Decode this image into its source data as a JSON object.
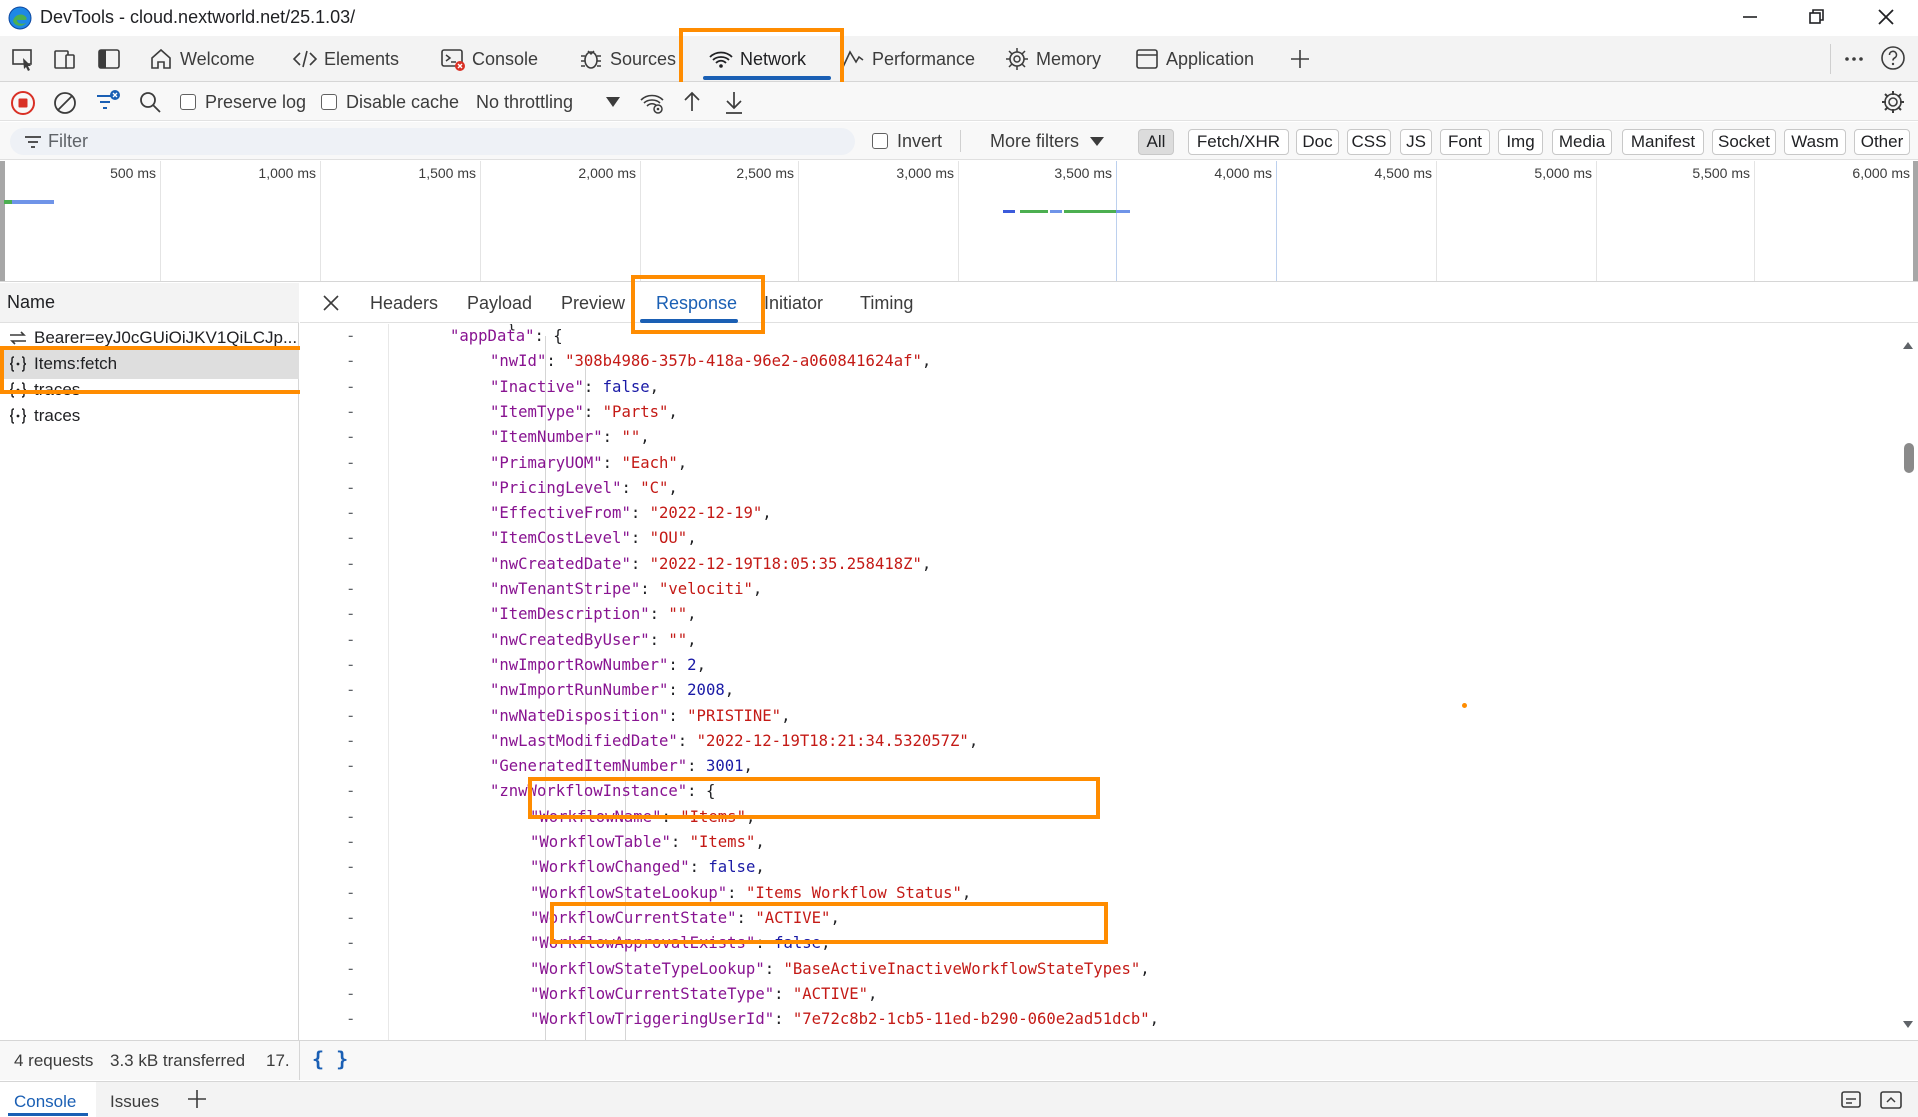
{
  "window": {
    "title": "DevTools - cloud.nextworld.net/25.1.03/"
  },
  "main_tabs": {
    "welcome": "Welcome",
    "elements": "Elements",
    "console": "Console",
    "sources": "Sources",
    "network": "Network",
    "performance": "Performance",
    "memory": "Memory",
    "application": "Application"
  },
  "toolbar": {
    "preserve_log": "Preserve log",
    "disable_cache": "Disable cache",
    "throttling": "No throttling"
  },
  "filterbar": {
    "filter_placeholder": "Filter",
    "invert": "Invert",
    "more_filters": "More filters",
    "chips": [
      "All",
      "Fetch/XHR",
      "Doc",
      "CSS",
      "JS",
      "Font",
      "Img",
      "Media",
      "Manifest",
      "Socket",
      "Wasm",
      "Other"
    ]
  },
  "timeline": {
    "ticks": [
      "500 ms",
      "1,000 ms",
      "1,500 ms",
      "2,000 ms",
      "2,500 ms",
      "3,000 ms",
      "3,500 ms",
      "4,000 ms",
      "4,500 ms",
      "5,000 ms",
      "5,500 ms",
      "6,000 ms"
    ]
  },
  "request_list": {
    "header": "Name",
    "items": [
      "Bearer=eyJ0cGUiOiJKV1QiLCJp...",
      "Items:fetch",
      "traces",
      "traces"
    ]
  },
  "details": {
    "tabs": {
      "headers": "Headers",
      "payload": "Payload",
      "preview": "Preview",
      "response": "Response",
      "initiator": "Initiator",
      "timing": "Timing"
    },
    "response_lines": [
      {
        "indent": 0,
        "key": "appData",
        "value": "{",
        "vtype": "open"
      },
      {
        "indent": 1,
        "key": "nwId",
        "value": "\"308b4986-357b-418a-96e2-a060841624af\"",
        "vtype": "string"
      },
      {
        "indent": 1,
        "key": "Inactive",
        "value": "false",
        "vtype": "keyword"
      },
      {
        "indent": 1,
        "key": "ItemType",
        "value": "\"Parts\"",
        "vtype": "string"
      },
      {
        "indent": 1,
        "key": "ItemNumber",
        "value": "\"\"",
        "vtype": "string"
      },
      {
        "indent": 1,
        "key": "PrimaryUOM",
        "value": "\"Each\"",
        "vtype": "string"
      },
      {
        "indent": 1,
        "key": "PricingLevel",
        "value": "\"C\"",
        "vtype": "string"
      },
      {
        "indent": 1,
        "key": "EffectiveFrom",
        "value": "\"2022-12-19\"",
        "vtype": "string"
      },
      {
        "indent": 1,
        "key": "ItemCostLevel",
        "value": "\"OU\"",
        "vtype": "string"
      },
      {
        "indent": 1,
        "key": "nwCreatedDate",
        "value": "\"2022-12-19T18:05:35.258418Z\"",
        "vtype": "string"
      },
      {
        "indent": 1,
        "key": "nwTenantStripe",
        "value": "\"velociti\"",
        "vtype": "string"
      },
      {
        "indent": 1,
        "key": "ItemDescription",
        "value": "\"\"",
        "vtype": "string"
      },
      {
        "indent": 1,
        "key": "nwCreatedByUser",
        "value": "\"\"",
        "vtype": "string"
      },
      {
        "indent": 1,
        "key": "nwImportRowNumber",
        "value": "2",
        "vtype": "number"
      },
      {
        "indent": 1,
        "key": "nwImportRunNumber",
        "value": "2008",
        "vtype": "number"
      },
      {
        "indent": 1,
        "key": "nwNateDisposition",
        "value": "\"PRISTINE\"",
        "vtype": "string"
      },
      {
        "indent": 1,
        "key": "nwLastModifiedDate",
        "value": "\"2022-12-19T18:21:34.532057Z\"",
        "vtype": "string"
      },
      {
        "indent": 1,
        "key": "GeneratedItemNumber",
        "value": "3001",
        "vtype": "number"
      },
      {
        "indent": 1,
        "key": "znwWorkflowInstance",
        "value": "{",
        "vtype": "open"
      },
      {
        "indent": 2,
        "key": "WorkflowName",
        "value": "\"Items\"",
        "vtype": "string"
      },
      {
        "indent": 2,
        "key": "WorkflowTable",
        "value": "\"Items\"",
        "vtype": "string"
      },
      {
        "indent": 2,
        "key": "WorkflowChanged",
        "value": "false",
        "vtype": "keyword"
      },
      {
        "indent": 2,
        "key": "WorkflowStateLookup",
        "value": "\"Items Workflow Status\"",
        "vtype": "string"
      },
      {
        "indent": 2,
        "key": "WorkflowCurrentState",
        "value": "\"ACTIVE\"",
        "vtype": "string"
      },
      {
        "indent": 2,
        "key": "WorkflowApprovalExists",
        "value": "false",
        "vtype": "keyword"
      },
      {
        "indent": 2,
        "key": "WorkflowStateTypeLookup",
        "value": "\"BaseActiveInactiveWorkflowStateTypes\"",
        "vtype": "string"
      },
      {
        "indent": 2,
        "key": "WorkflowCurrentStateType",
        "value": "\"ACTIVE\"",
        "vtype": "string"
      },
      {
        "indent": 2,
        "key": "WorkflowTriggeringUserId",
        "value": "\"7e72c8b2-1cb5-11ed-b290-060e2ad51dcb\"",
        "vtype": "string"
      }
    ]
  },
  "statusbar": {
    "requests": "4 requests",
    "transferred": "3.3 kB transferred",
    "more": "17.",
    "pretty_print": "{ }"
  },
  "drawer": {
    "console": "Console",
    "issues": "Issues"
  },
  "colors": {
    "highlight": "#ff8c00",
    "accent": "#1a5fb4"
  }
}
